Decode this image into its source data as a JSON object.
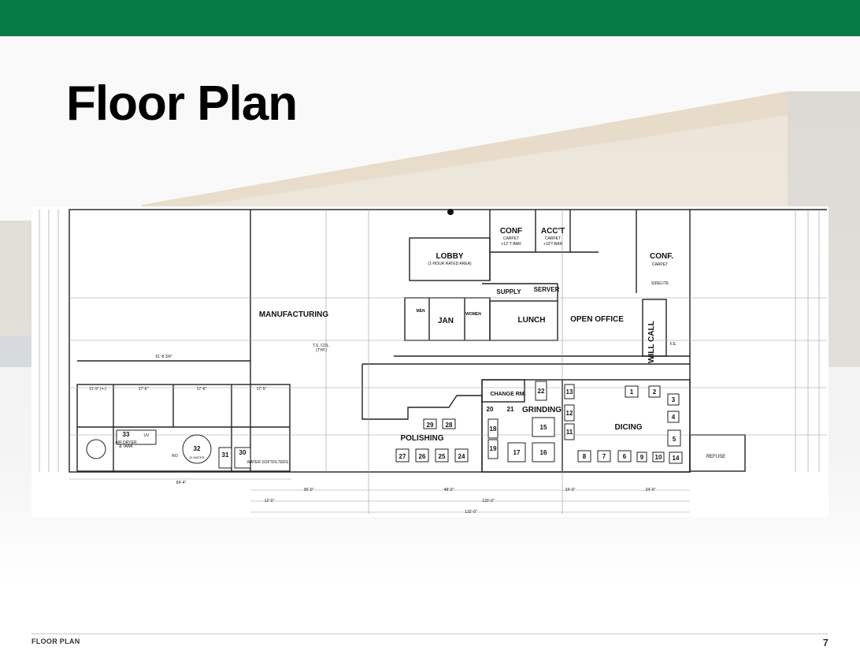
{
  "page": {
    "title": "Floor Plan",
    "footer_label": "FLOOR PLAN",
    "page_number": "7",
    "brand_color": "#067a45"
  },
  "plan": {
    "rooms": {
      "manufacturing": "MANUFACTURING",
      "lobby": "LOBBY",
      "lobby_note": "(1-HOUR RATED AREA)",
      "conf1": "CONF",
      "conf1_note1": "CARPET",
      "conf1_note2": "+12' T-BAR",
      "acct": "ACC'T",
      "acct_note1": "CARPET",
      "acct_note2": "+10'T-BAR",
      "conf2": "CONF.",
      "conf2_note": "CARPET",
      "supply": "SUPPLY",
      "server": "SERVER",
      "men": "MEN",
      "women": "WOMEN",
      "jan": "JAN",
      "lunch": "LUNCH",
      "open_office": "OPEN OFFICE",
      "will_call": "WILL CALL",
      "change_rm": "CHANGE RM.",
      "grinding": "GRINDING",
      "polishing": "POLISHING",
      "dicing": "DICING",
      "refuse": "REFUSE",
      "air_dryer": "AIR DRYER",
      "tank": "& TANK",
      "di_water": "DI WATER",
      "water_soft": "WATER SOFT.",
      "filters": "FILTERS",
      "ts_col": "T.S. COL.",
      "typ": "(TYP.)",
      "sidelite": "SIDELITE",
      "fe": "F.E.",
      "uv": "UV",
      "ro": "RO"
    },
    "dimensions": {
      "d1": "51'-8 3/4\"",
      "d2": "64'-4\"",
      "d3": "36'-0\"",
      "d4": "48'-0\"",
      "d5": "24'-0\"",
      "d6": "24'-0\"",
      "d7": "12'-0\"",
      "d8": "120'-0\"",
      "d9": "132'-0\"",
      "d10": "17'-6\"",
      "d11": "17'-6\"",
      "d12": "17'-5\"",
      "d13": "11'-9\" (+-)"
    }
  }
}
